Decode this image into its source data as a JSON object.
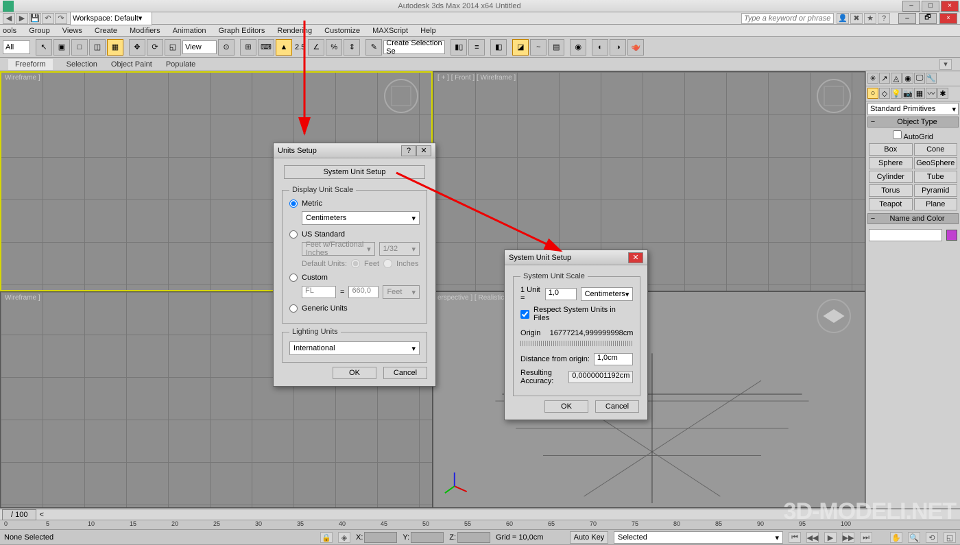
{
  "app": {
    "title": "Autodesk 3ds Max 2014 x64   Untitled",
    "workspace_label": "Workspace: Default",
    "search_placeholder": "Type a keyword or phrase"
  },
  "menubar": [
    "ools",
    "Group",
    "Views",
    "Create",
    "Modifiers",
    "Animation",
    "Graph Editors",
    "Rendering",
    "Customize",
    "MAXScript",
    "Help"
  ],
  "toolbar": {
    "all_label": "All",
    "view_label": "View",
    "num": "2.5",
    "sel_set": "Create Selection Se"
  },
  "ribbon": [
    "Freeform",
    "Selection",
    "Object Paint",
    "Populate"
  ],
  "viewports": {
    "top": "Wireframe ]",
    "front": "[ + ] [ Front ] [ Wireframe ]",
    "left": "Wireframe ]",
    "persp": "erspective ] [ Realistic ]"
  },
  "sidepanel": {
    "dropdown": "Standard Primitives",
    "rollout1": "Object Type",
    "autogrid": "AutoGrid",
    "prims": [
      "Box",
      "Cone",
      "Sphere",
      "GeoSphere",
      "Cylinder",
      "Tube",
      "Torus",
      "Pyramid",
      "Teapot",
      "Plane"
    ],
    "rollout2": "Name and Color"
  },
  "dialog1": {
    "title": "Units Setup",
    "sys_btn": "System Unit Setup",
    "group1": "Display Unit Scale",
    "opt_metric": "Metric",
    "metric_combo": "Centimeters",
    "opt_us": "US Standard",
    "us_combo1": "Feet w/Fractional Inches",
    "us_combo2": "1/32",
    "default_units": "Default Units:",
    "feet": "Feet",
    "inches": "Inches",
    "opt_custom": "Custom",
    "custom_unit": "FL",
    "custom_eq": "=",
    "custom_val": "660,0",
    "custom_combo": "Feet",
    "opt_generic": "Generic Units",
    "group2": "Lighting Units",
    "lighting_combo": "International",
    "ok": "OK",
    "cancel": "Cancel"
  },
  "dialog2": {
    "title": "System Unit Setup",
    "group": "System Unit Scale",
    "oneunit": "1 Unit =",
    "val": "1,0",
    "unit": "Centimeters",
    "respect": "Respect System Units in Files",
    "origin_lbl": "Origin",
    "origin_val": "16777214,999999998cm",
    "dist_lbl": "Distance from origin:",
    "dist_val": "1,0cm",
    "acc_lbl": "Resulting Accuracy:",
    "acc_val": "0,0000001192cm",
    "ok": "OK",
    "cancel": "Cancel"
  },
  "status": {
    "slider": "/ 100",
    "ticks": [
      "0",
      "5",
      "10",
      "15",
      "20",
      "25",
      "30",
      "35",
      "40",
      "45",
      "50",
      "55",
      "60",
      "65",
      "70",
      "75",
      "80",
      "85",
      "90",
      "95",
      "100"
    ],
    "selected": "None Selected",
    "x": "X:",
    "y": "Y:",
    "z": "Z:",
    "grid": "Grid = 10,0cm",
    "autokey": "Auto Key",
    "selected_dd": "Selected"
  },
  "watermark": "3D-MODELI.NET"
}
